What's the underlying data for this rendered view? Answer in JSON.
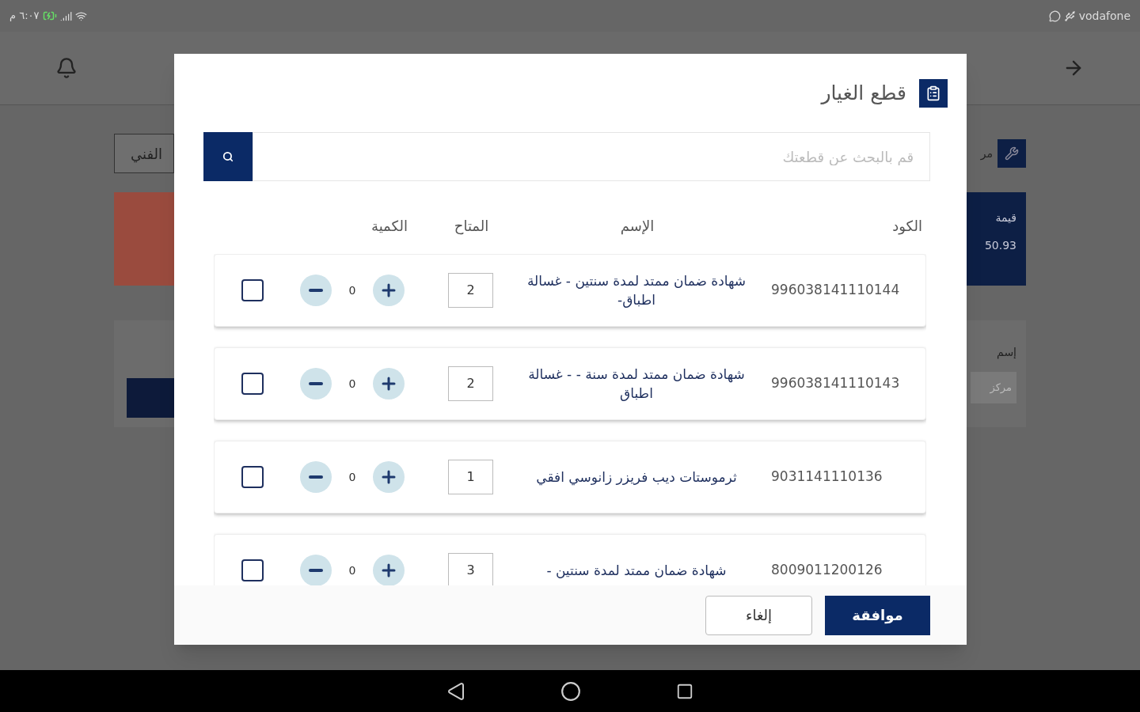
{
  "status_bar": {
    "time": "٦:٠٧ م",
    "carrier": "vodafone"
  },
  "background": {
    "technician_field": "الفني",
    "center_label": "مر",
    "value_label": "قيمة",
    "value_amount": "50.93",
    "name_label": "إسم",
    "name_field": "مركز"
  },
  "dialog": {
    "title": "قطع الغيار",
    "search": {
      "placeholder": "قم بالبحث عن قطعتك"
    },
    "columns": [
      "الكود",
      "الإسم",
      "المتاح",
      "الكمية"
    ],
    "rows": [
      {
        "code": "996038141110144",
        "name": "شهادة ضمان ممتد لمدة سنتين - غسالة اطباق-",
        "available": "2",
        "quantity": "0",
        "checked": false
      },
      {
        "code": "996038141110143",
        "name": "شهادة ضمان ممتد لمدة سنة - - غسالة اطباق",
        "available": "2",
        "quantity": "0",
        "checked": false
      },
      {
        "code": "9031141110136",
        "name": "ثرموستات ديب فريزر زانوسي افقي",
        "available": "1",
        "quantity": "0",
        "checked": false
      },
      {
        "code": "8009011200126",
        "name": "شهادة ضمان ممتد لمدة سنتين -",
        "available": "3",
        "quantity": "0",
        "checked": false
      }
    ],
    "buttons": {
      "confirm": "موافقة",
      "cancel": "إلغاء"
    }
  }
}
